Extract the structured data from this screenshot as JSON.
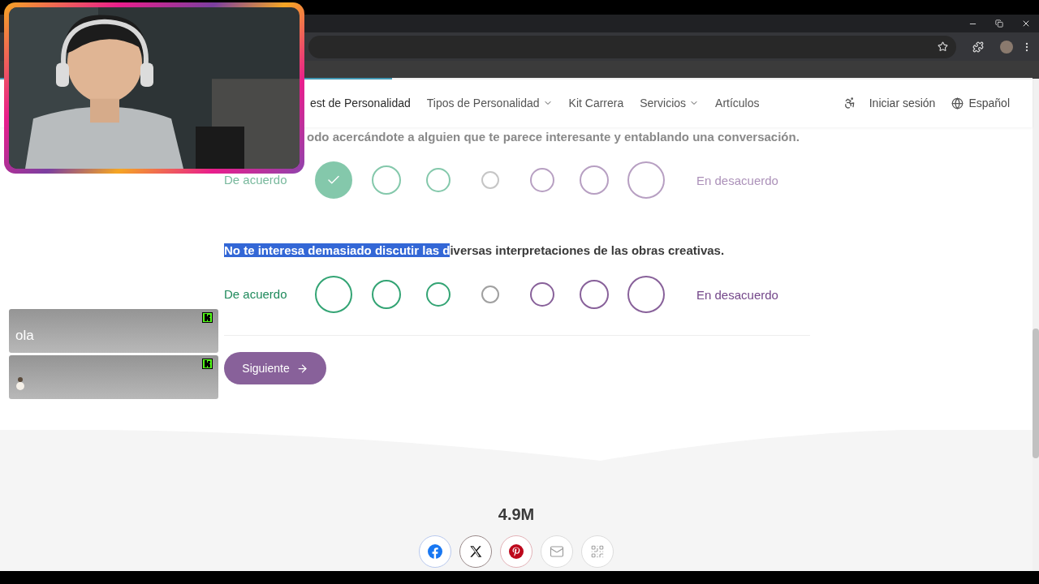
{
  "progress": {
    "level": 0.38
  },
  "nav": {
    "items": [
      {
        "label": "est de Personalidad",
        "has_menu": false,
        "selected": true
      },
      {
        "label": "Tipos de Personalidad",
        "has_menu": true,
        "selected": false
      },
      {
        "label": "Kit Carrera",
        "has_menu": false,
        "selected": false
      },
      {
        "label": "Servicios",
        "has_menu": true,
        "selected": false
      },
      {
        "label": "Artículos",
        "has_menu": false,
        "selected": false
      }
    ],
    "login": "Iniciar sesión",
    "language": "Español"
  },
  "questions": [
    {
      "answered": true,
      "text": [
        {
          "part": "odo acercándote a alguien que te parece interesante y entablando una conversación.",
          "selected": false
        }
      ],
      "agree_label": "De acuerdo",
      "disagree_label": "En desacuerdo",
      "options": [
        {
          "selected": true
        },
        {
          "selected": false
        },
        {
          "selected": false
        },
        {
          "selected": false
        },
        {
          "selected": false
        },
        {
          "selected": false
        },
        {
          "selected": false
        }
      ]
    },
    {
      "answered": false,
      "text": [
        {
          "part": "No te interesa demasiado discutir las d",
          "selected": true
        },
        {
          "part": "iversas interpretaciones de las obras creativas.",
          "selected": false
        }
      ],
      "agree_label": "De acuerdo",
      "disagree_label": "En desacuerdo",
      "options": [
        {
          "selected": false
        },
        {
          "selected": false
        },
        {
          "selected": false
        },
        {
          "selected": false
        },
        {
          "selected": false
        },
        {
          "selected": false
        },
        {
          "selected": false
        }
      ]
    }
  ],
  "next_button": {
    "label": "Siguiente"
  },
  "stats": {
    "count": "4.9M"
  },
  "share": [
    {
      "kind": "facebook"
    },
    {
      "kind": "x"
    },
    {
      "kind": "pinterest"
    },
    {
      "kind": "email"
    },
    {
      "kind": "qr"
    }
  ],
  "chat": [
    {
      "kind": "text",
      "message": "ola"
    },
    {
      "kind": "emote"
    }
  ]
}
